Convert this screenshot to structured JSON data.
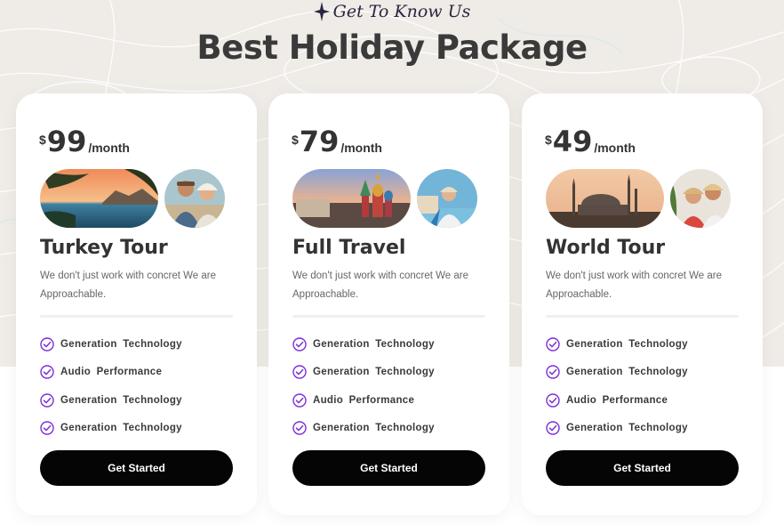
{
  "section": {
    "eyebrow": "Get To Know Us",
    "title": "Best Holiday Package"
  },
  "cards": [
    {
      "currency": "$",
      "price": "99",
      "period": "/month",
      "title": "Turkey Tour",
      "description": "We don't just work with concret We are Approachable.",
      "features": [
        "Generation  Technology",
        "Audio  Performance",
        "Generation  Technology",
        "Generation  Technology"
      ],
      "button": "Get Started"
    },
    {
      "currency": "$",
      "price": "79",
      "period": "/month",
      "title": "Full Travel",
      "description": "We don't just work with concret We are Approachable.",
      "features": [
        "Generation  Technology",
        "Generation  Technology",
        "Audio  Performance",
        "Generation  Technology"
      ],
      "button": "Get Started"
    },
    {
      "currency": "$",
      "price": "49",
      "period": "/month",
      "title": "World Tour",
      "description": "We don't just work with concret We are Approachable.",
      "features": [
        "Generation  Technology",
        "Generation  Technology",
        "Audio  Performance",
        "Generation  Technology"
      ],
      "button": "Get Started"
    }
  ],
  "colors": {
    "accent_check": "#7b2fd6",
    "button_bg": "#050505",
    "background_top": "#efebe6"
  },
  "icons": {
    "eyebrow": "sparkle-star-icon",
    "feature": "check-circle-icon"
  }
}
